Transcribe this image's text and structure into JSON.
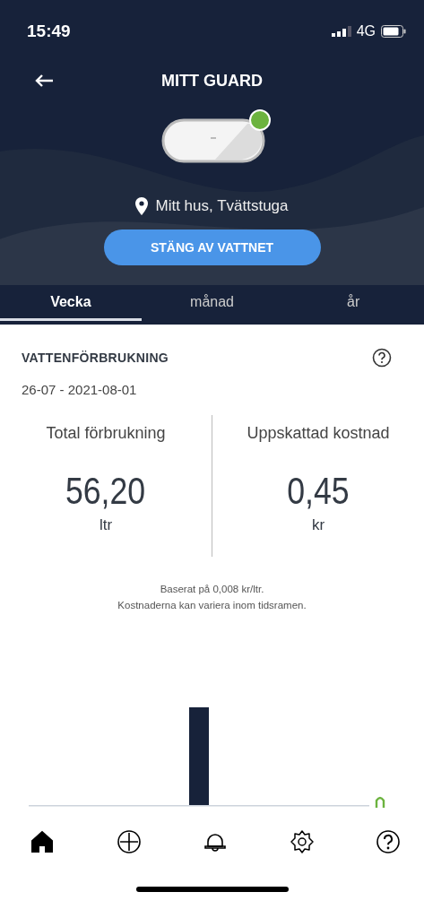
{
  "status_bar": {
    "time": "15:49",
    "network": "4G"
  },
  "header": {
    "title": "MITT GUARD"
  },
  "device": {
    "online": true
  },
  "location": "Mitt hus, Tvättstuga",
  "action_button": "STÄNG AV VATTNET",
  "tabs": [
    {
      "label": "Vecka",
      "selected": true
    },
    {
      "label": "månad",
      "selected": false
    },
    {
      "label": "år",
      "selected": false
    }
  ],
  "consumption": {
    "title": "VATTENFÖRBRUKNING",
    "period": "26-07 - 2021-08-01",
    "stats": [
      {
        "label": "Total förbrukning",
        "value": "56,20",
        "unit": "ltr"
      },
      {
        "label": "Uppskattad kostnad",
        "value": "0,45",
        "unit": "kr"
      }
    ],
    "notes": [
      "Baserat på 0,008 kr/ltr.",
      "Kostnaderna kan variera inom tidsramen."
    ]
  },
  "nav": [
    {
      "kind": "home",
      "selected": true
    },
    {
      "kind": "add",
      "selected": false
    },
    {
      "kind": "bell",
      "selected": false
    },
    {
      "kind": "settings",
      "selected": false
    },
    {
      "kind": "help",
      "selected": false
    }
  ]
}
